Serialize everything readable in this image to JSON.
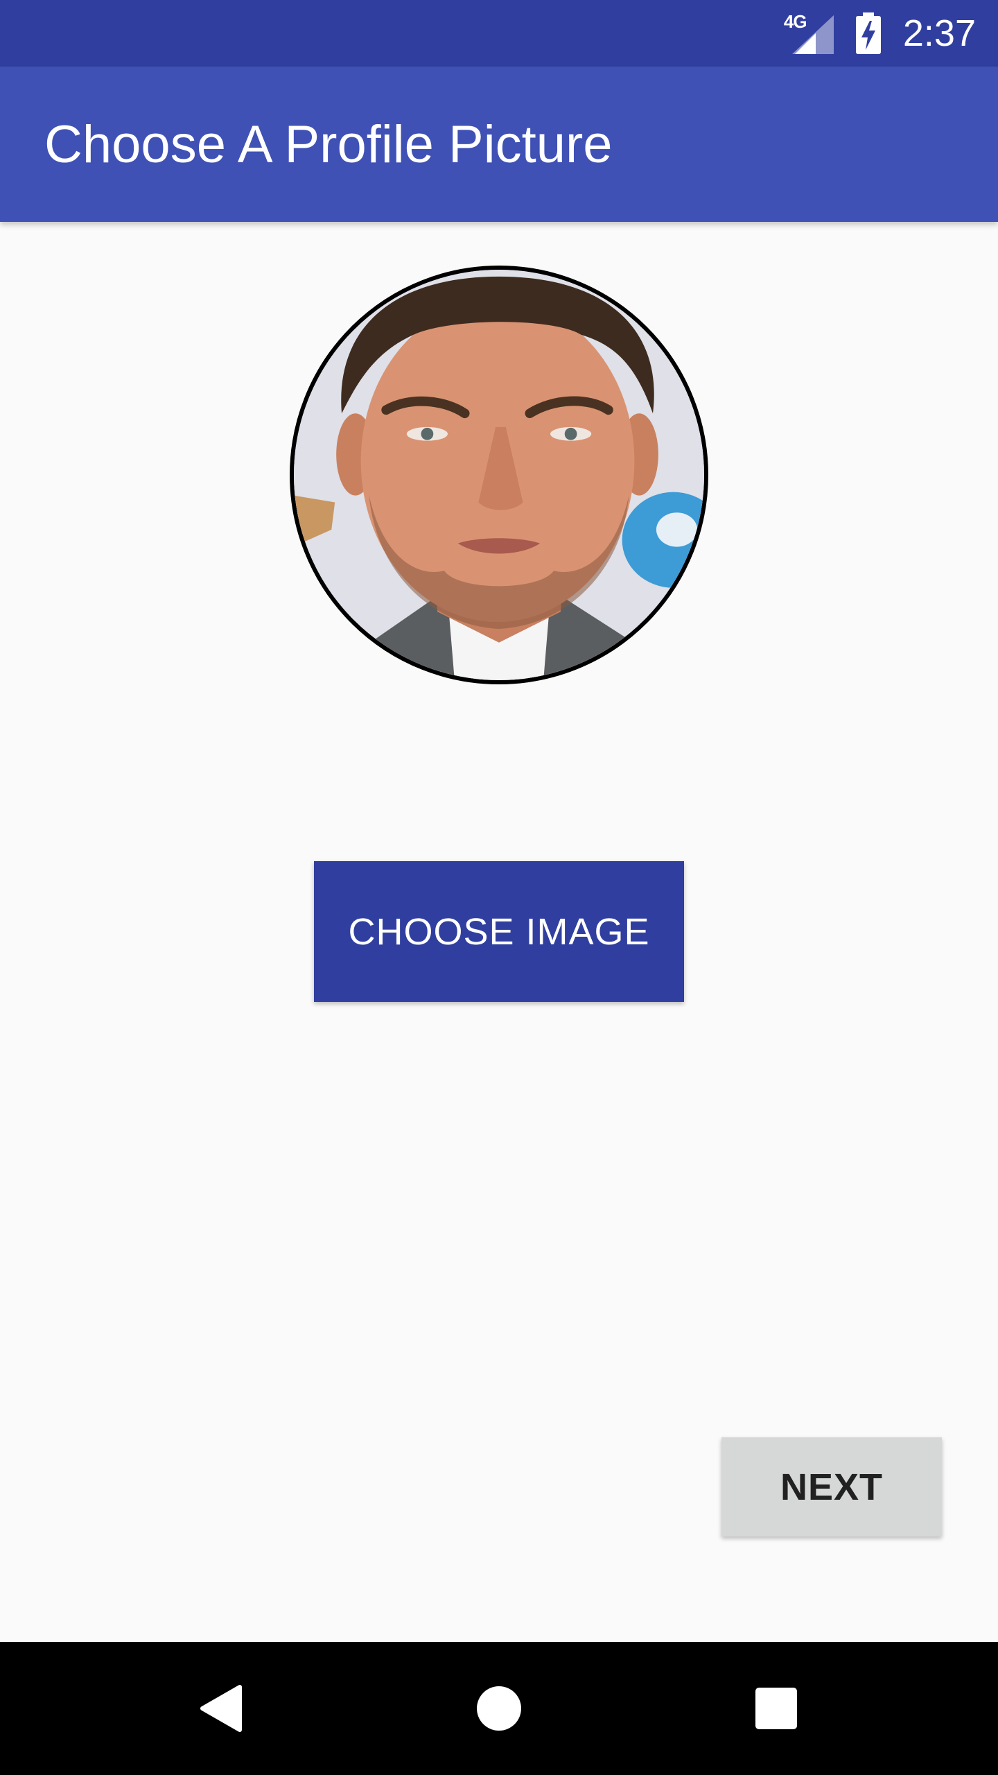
{
  "status_bar": {
    "network_label": "4G",
    "time": "2:37",
    "icons": [
      "signal-icon",
      "battery-charging-icon"
    ]
  },
  "app_bar": {
    "title": "Choose A Profile Picture"
  },
  "profile": {
    "avatar_description": "profile-photo"
  },
  "buttons": {
    "choose_image": "CHOOSE IMAGE",
    "next": "NEXT"
  },
  "nav_bar": {
    "icons": [
      "back-icon",
      "home-icon",
      "recents-icon"
    ]
  },
  "colors": {
    "status_bar": "#303f9f",
    "app_bar": "#3f51b5",
    "primary_button": "#303f9f",
    "secondary_button": "#d6d7d7",
    "background": "#fafafa"
  }
}
